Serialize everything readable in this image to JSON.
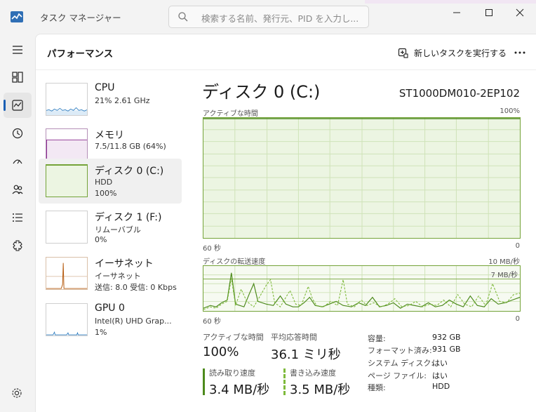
{
  "window": {
    "title": "タスク マネージャー",
    "search_placeholder": "検索する名前、発行元、PID を入力し..."
  },
  "header": {
    "page_title": "パフォーマンス",
    "run_task_label": "新しいタスクを実行する",
    "more_label": "..."
  },
  "rail": [
    {
      "name": "hamburger-menu-icon"
    },
    {
      "name": "processes-icon"
    },
    {
      "name": "performance-icon",
      "active": true
    },
    {
      "name": "app-history-icon"
    },
    {
      "name": "startup-apps-icon"
    },
    {
      "name": "users-icon"
    },
    {
      "name": "details-icon"
    },
    {
      "name": "services-icon"
    }
  ],
  "devices": [
    {
      "name": "CPU",
      "l2": "21%  2.61 GHz",
      "l3": ""
    },
    {
      "name": "メモリ",
      "l2": "7.5/11.8 GB (64%)",
      "l3": ""
    },
    {
      "name": "ディスク 0 (C:)",
      "l2": "HDD",
      "l3": "100%",
      "selected": true
    },
    {
      "name": "ディスク 1 (F:)",
      "l2": "リムーバブル",
      "l3": "0%"
    },
    {
      "name": "イーサネット",
      "l2": "イーサネット",
      "l3": "送信: 8.0  受信: 0 Kbps"
    },
    {
      "name": "GPU 0",
      "l2": "Intel(R) UHD Grap...",
      "l3": "1%"
    }
  ],
  "detail": {
    "title": "ディスク 0 (C:)",
    "model": "ST1000DM010-2EP102",
    "graph1": {
      "label": "アクティブな時間",
      "max": "100%",
      "time": "60 秒",
      "min": "0"
    },
    "graph2": {
      "label": "ディスクの転送速度",
      "max": "10 MB/秒",
      "marker": "7 MB/秒",
      "time": "60 秒",
      "min": "0"
    },
    "stats": {
      "active_label": "アクティブな時間",
      "active_value": "100%",
      "response_label": "平均応答時間",
      "response_value": "36.1 ミリ秒",
      "read_label": "読み取り速度",
      "read_value": "3.4 MB/秒",
      "write_label": "書き込み速度",
      "write_value": "3.5 MB/秒"
    },
    "props": [
      {
        "key": "容量:",
        "value": "932 GB"
      },
      {
        "key": "フォーマット済み:",
        "value": "931 GB"
      },
      {
        "key": "システム ディスク:",
        "value": "はい"
      },
      {
        "key": "ページ ファイル:",
        "value": "はい"
      },
      {
        "key": "種類:",
        "value": "HDD"
      }
    ]
  },
  "colors": {
    "cpu": "#2b7bbf",
    "memory": "#8a2a8f",
    "disk": "#74a338",
    "ethernet": "#b55a0e",
    "accent": "#1a5fb4"
  }
}
